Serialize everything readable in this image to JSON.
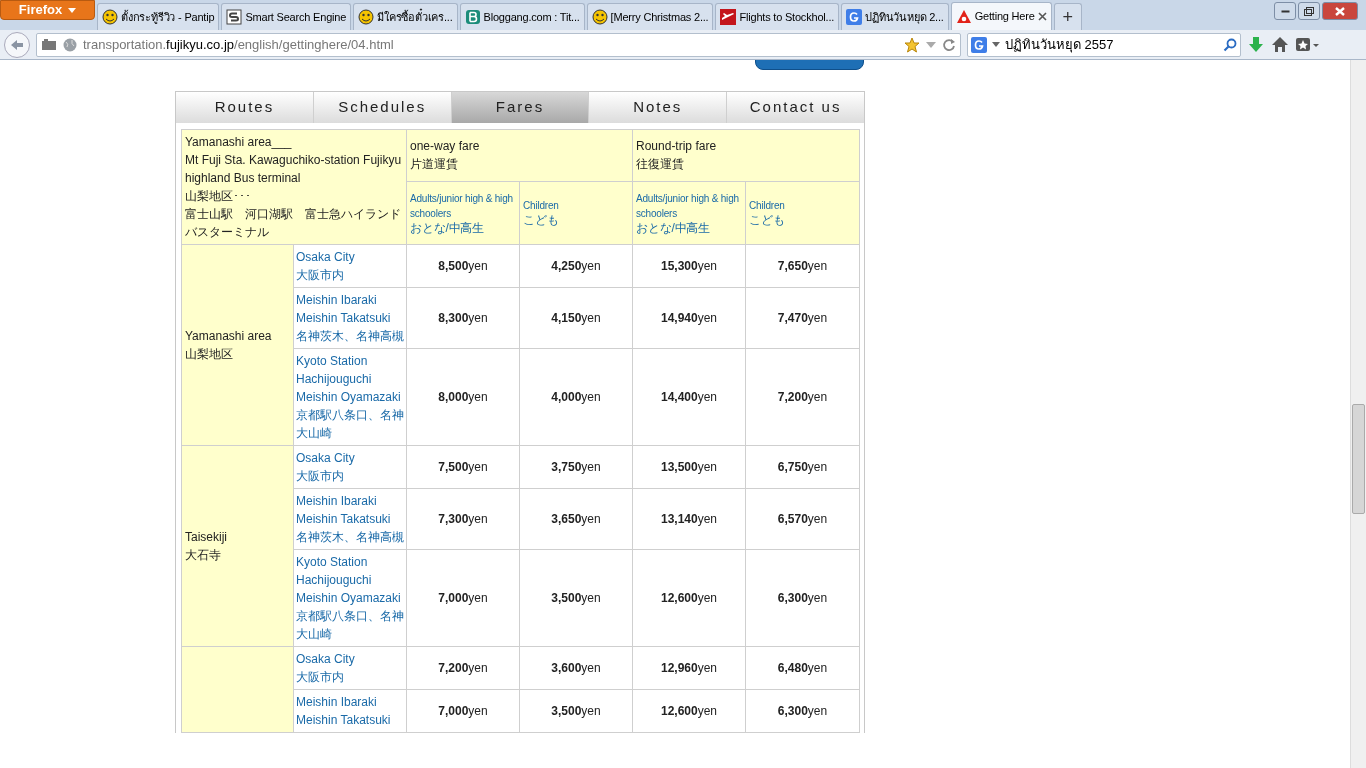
{
  "browser": {
    "menu_button": "Firefox",
    "tabs": [
      {
        "title": "ตั้งกระทู้รีวิว - Pantip",
        "kind": "smiley",
        "selected": false
      },
      {
        "title": "Smart Search Engine",
        "kind": "letter-s",
        "selected": false
      },
      {
        "title": "มีใครซื้อตั๋วเคร...",
        "kind": "smiley",
        "selected": false
      },
      {
        "title": "Bloggang.com : Tit...",
        "kind": "letter-b",
        "selected": false
      },
      {
        "title": "[Merry Christmas 2...",
        "kind": "smiley",
        "selected": false
      },
      {
        "title": "Flights to Stockhol...",
        "kind": "plane",
        "selected": false
      },
      {
        "title": "ปฏิทินวันหยุด 2...",
        "kind": "letter-g",
        "selected": false
      },
      {
        "title": "Getting Here",
        "kind": "site",
        "selected": true
      }
    ],
    "new_tab": "+",
    "address": {
      "host_prefix": "transportation.",
      "host": "fujikyu.co.jp",
      "path": "/english/gettinghere/04.html"
    },
    "search": {
      "value": "ปฏิทินวันหยุด 2557"
    }
  },
  "nav_tabs": [
    {
      "label": "Routes",
      "selected": false
    },
    {
      "label": "Schedules",
      "selected": false
    },
    {
      "label": "Fares",
      "selected": true
    },
    {
      "label": "Notes",
      "selected": false
    },
    {
      "label": "Contact us",
      "selected": false
    }
  ],
  "table": {
    "corner": [
      "Yamanashi area___",
      "Mt Fuji Sta. Kawaguchiko-station Fujikyu highland Bus terminal",
      "山梨地区･･･",
      "富士山駅　河口湖駅　富士急ハイランドバスターミナル"
    ],
    "fare_groups": [
      {
        "title": [
          "one-way fare",
          "片道運賃"
        ]
      },
      {
        "title": [
          "Round-trip fare",
          "往復運賃"
        ]
      }
    ],
    "sub_columns": [
      [
        "Adults/junior high & high schoolers",
        "おとな/中高生"
      ],
      [
        "Children",
        "こども"
      ],
      [
        "Adults/junior high & high schoolers",
        "おとな/中高生"
      ],
      [
        "Children",
        "こども"
      ]
    ],
    "areas": [
      {
        "name": [
          "Yamanashi area",
          "山梨地区"
        ],
        "rows": [
          {
            "destination": [
              "Osaka City",
              "大阪市内"
            ],
            "fares": [
              "**8,500**yen",
              "**4,250**yen",
              "**15,300**yen",
              "**7,650**yen"
            ]
          },
          {
            "destination": [
              "Meishin Ibaraki",
              "Meishin Takatsuki",
              "名神茨木、名神高槻"
            ],
            "fares": [
              "**8,300**yen",
              "**4,150**yen",
              "**14,940**yen",
              "**7,470**yen"
            ]
          },
          {
            "destination": [
              "Kyoto Station Hachijouguchi Meishin Oyamazaki",
              "京都駅八条口、名神大山崎"
            ],
            "fares": [
              "**8,000**yen",
              "**4,000**yen",
              "**14,400**yen",
              "**7,200**yen"
            ]
          }
        ]
      },
      {
        "name": [
          "Taisekiji",
          "大石寺"
        ],
        "rows": [
          {
            "destination": [
              "Osaka City",
              "大阪市内"
            ],
            "fares": [
              "**7,500**yen",
              "**3,750**yen",
              "**13,500**yen",
              "**6,750**yen"
            ]
          },
          {
            "destination": [
              "Meishin Ibaraki",
              "Meishin Takatsuki",
              "名神茨木、名神高槻"
            ],
            "fares": [
              "**7,300**yen",
              "**3,650**yen",
              "**13,140**yen",
              "**6,570**yen"
            ]
          },
          {
            "destination": [
              "Kyoto Station Hachijouguchi Meishin Oyamazaki",
              "京都駅八条口、名神大山崎"
            ],
            "fares": [
              "**7,000**yen",
              "**3,500**yen",
              "**12,600**yen",
              "**6,300**yen"
            ]
          }
        ]
      },
      {
        "rows": [
          {
            "destination": [
              "Osaka City",
              "大阪市内"
            ],
            "fares": [
              "**7,200**yen",
              "**3,600**yen",
              "**12,960**yen",
              "**6,480**yen"
            ]
          },
          {
            "destination": [
              "Meishin Ibaraki",
              "Meishin Takatsuki"
            ],
            "fares": [
              "**7,000**yen",
              "**3,500**yen",
              "**12,600**yen",
              "**6,300**yen"
            ]
          }
        ]
      }
    ]
  }
}
